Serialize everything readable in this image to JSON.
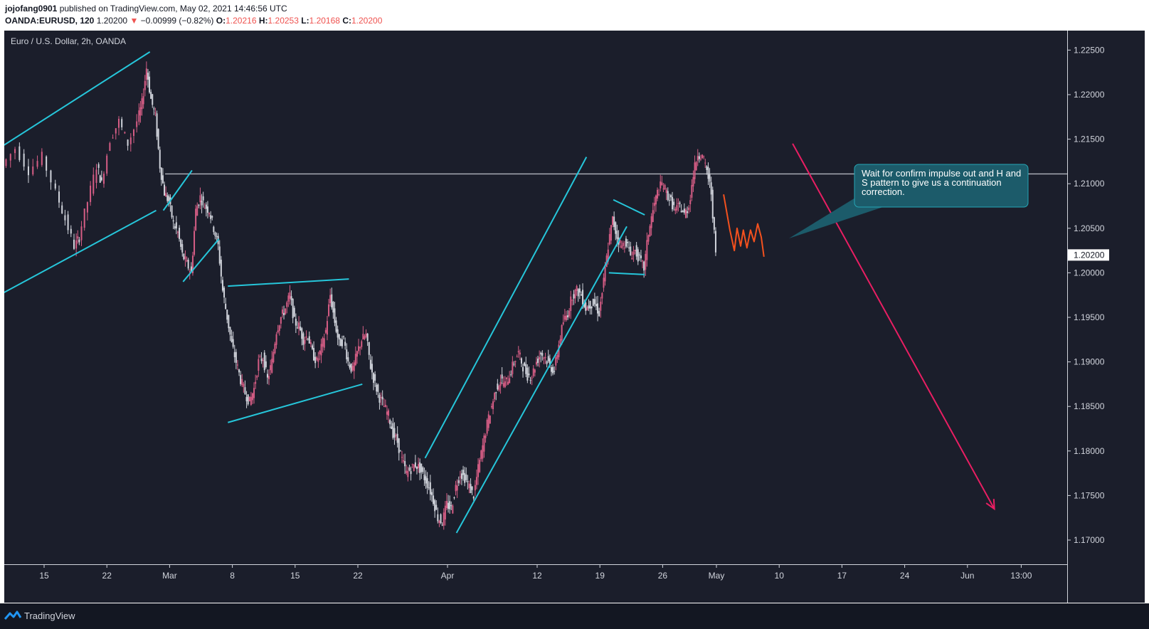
{
  "header": {
    "author": "jojofang0901",
    "published": "published on TradingView.com, May 02, 2021 14:46:56 UTC",
    "symbol": "OANDA:EURUSD, 120",
    "price": "1.20200",
    "change": "−0.00999 (−0.82%)",
    "open_label": "O:",
    "open": "1.20216",
    "high_label": "H:",
    "high": "1.20253",
    "low_label": "L:",
    "low": "1.20168",
    "close_label": "C:",
    "close": "1.20200"
  },
  "footer": {
    "brand": "TradingView",
    "logo_icon": "tradingview-logo-icon"
  },
  "colors": {
    "background": "#1b1e2b",
    "up": "#d65d85",
    "down": "#d1d4dc",
    "trendline": "#26c6da",
    "arrow": "#e91e63",
    "sketch": "#f4511e",
    "note_bg": "#1c5b6a",
    "note_border": "#26a6b5"
  },
  "chart_data": {
    "type": "candlestick",
    "title": "Euro / U.S. Dollar, 2h, OANDA",
    "ylim": [
      1.167,
      1.228
    ],
    "y_ticks": [
      "1.22500",
      "1.22000",
      "1.21500",
      "1.21000",
      "1.20500",
      "1.20000",
      "1.19500",
      "1.19000",
      "1.18500",
      "1.18000",
      "1.17500",
      "1.17000"
    ],
    "x_ticks": [
      {
        "label": "15",
        "day": 0
      },
      {
        "label": "22",
        "day": 7
      },
      {
        "label": "Mar",
        "day": 14
      },
      {
        "label": "8",
        "day": 21
      },
      {
        "label": "15",
        "day": 28
      },
      {
        "label": "22",
        "day": 35
      },
      {
        "label": "Apr",
        "day": 45
      },
      {
        "label": "12",
        "day": 55
      },
      {
        "label": "19",
        "day": 62
      },
      {
        "label": "26",
        "day": 69
      },
      {
        "label": "May",
        "day": 75
      },
      {
        "label": "10",
        "day": 82
      },
      {
        "label": "17",
        "day": 89
      },
      {
        "label": "24",
        "day": 96
      },
      {
        "label": "Jun",
        "day": 103
      },
      {
        "label": "13:00",
        "day": 109
      }
    ],
    "last_price": 1.202,
    "resistance_level": 1.2111,
    "price_path": [
      [
        -4.5,
        1.212
      ],
      [
        -3,
        1.214
      ],
      [
        -1.5,
        1.2115
      ],
      [
        0,
        1.213
      ],
      [
        1.5,
        1.209
      ],
      [
        2.5,
        1.206
      ],
      [
        3.5,
        1.203
      ],
      [
        4,
        1.204
      ],
      [
        5,
        1.208
      ],
      [
        6,
        1.212
      ],
      [
        6.5,
        1.21
      ],
      [
        7.5,
        1.215
      ],
      [
        8.5,
        1.217
      ],
      [
        9.5,
        1.2145
      ],
      [
        10.5,
        1.217
      ],
      [
        11,
        1.219
      ],
      [
        11.5,
        1.223
      ],
      [
        12,
        1.2195
      ],
      [
        12.5,
        1.2175
      ],
      [
        13,
        1.212
      ],
      [
        13.5,
        1.209
      ],
      [
        14,
        1.208
      ],
      [
        14.5,
        1.2055
      ],
      [
        15,
        1.2045
      ],
      [
        15.5,
        1.202
      ],
      [
        16,
        1.201
      ],
      [
        16.5,
        1.2
      ],
      [
        17,
        1.207
      ],
      [
        17.5,
        1.2085
      ],
      [
        18,
        1.2075
      ],
      [
        18.5,
        1.207
      ],
      [
        19,
        1.205
      ],
      [
        19.5,
        1.203
      ],
      [
        20,
        1.198
      ],
      [
        20.5,
        1.195
      ],
      [
        21,
        1.192
      ],
      [
        21.5,
        1.19
      ],
      [
        22,
        1.188
      ],
      [
        22.5,
        1.1865
      ],
      [
        23,
        1.1855
      ],
      [
        23.5,
        1.187
      ],
      [
        24,
        1.19
      ],
      [
        24.5,
        1.1905
      ],
      [
        25,
        1.188
      ],
      [
        25.5,
        1.19
      ],
      [
        26,
        1.1935
      ],
      [
        26.5,
        1.195
      ],
      [
        27,
        1.196
      ],
      [
        27.5,
        1.1975
      ],
      [
        28,
        1.1945
      ],
      [
        28.5,
        1.194
      ],
      [
        29,
        1.1925
      ],
      [
        29.5,
        1.193
      ],
      [
        30,
        1.191
      ],
      [
        30.5,
        1.19
      ],
      [
        31,
        1.1915
      ],
      [
        31.5,
        1.1935
      ],
      [
        32,
        1.1975
      ],
      [
        32.5,
        1.1945
      ],
      [
        33,
        1.192
      ],
      [
        33.5,
        1.1925
      ],
      [
        34,
        1.19
      ],
      [
        34.5,
        1.189
      ],
      [
        35,
        1.191
      ],
      [
        35.5,
        1.1925
      ],
      [
        36,
        1.193
      ],
      [
        36.5,
        1.1895
      ],
      [
        37,
        1.1875
      ],
      [
        37.5,
        1.186
      ],
      [
        38,
        1.185
      ],
      [
        38.5,
        1.184
      ],
      [
        39,
        1.182
      ],
      [
        39.5,
        1.181
      ],
      [
        40,
        1.179
      ],
      [
        40.5,
        1.1775
      ],
      [
        41,
        1.178
      ],
      [
        41.5,
        1.1785
      ],
      [
        42,
        1.178
      ],
      [
        42.5,
        1.177
      ],
      [
        43,
        1.176
      ],
      [
        43.5,
        1.1745
      ],
      [
        44,
        1.1725
      ],
      [
        44.5,
        1.172
      ],
      [
        45,
        1.174
      ],
      [
        45.5,
        1.1735
      ],
      [
        46,
        1.176
      ],
      [
        46.5,
        1.1775
      ],
      [
        47,
        1.177
      ],
      [
        47.5,
        1.176
      ],
      [
        48,
        1.175
      ],
      [
        48.5,
        1.178
      ],
      [
        49,
        1.1805
      ],
      [
        49.5,
        1.183
      ],
      [
        50,
        1.185
      ],
      [
        50.5,
        1.187
      ],
      [
        51,
        1.188
      ],
      [
        51.5,
        1.1875
      ],
      [
        52,
        1.1885
      ],
      [
        52.5,
        1.19
      ],
      [
        53,
        1.191
      ],
      [
        53.5,
        1.1895
      ],
      [
        54,
        1.1885
      ],
      [
        54.5,
        1.1885
      ],
      [
        55,
        1.19
      ],
      [
        55.5,
        1.191
      ],
      [
        56,
        1.1905
      ],
      [
        56.5,
        1.1895
      ],
      [
        57,
        1.189
      ],
      [
        57.5,
        1.192
      ],
      [
        58,
        1.1945
      ],
      [
        58.5,
        1.1955
      ],
      [
        59,
        1.1975
      ],
      [
        59.5,
        1.198
      ],
      [
        60,
        1.1975
      ],
      [
        60.5,
        1.196
      ],
      [
        61,
        1.1965
      ],
      [
        61.5,
        1.1965
      ],
      [
        62,
        1.1955
      ],
      [
        62.5,
        1.199
      ],
      [
        63,
        1.203
      ],
      [
        63.5,
        1.206
      ],
      [
        64,
        1.204
      ],
      [
        64.5,
        1.203
      ],
      [
        65,
        1.2035
      ],
      [
        65.5,
        1.202
      ],
      [
        66,
        1.2025
      ],
      [
        66.5,
        1.2015
      ],
      [
        67,
        1.2005
      ],
      [
        67.5,
        1.2045
      ],
      [
        68,
        1.207
      ],
      [
        68.5,
        1.209
      ],
      [
        69,
        1.21
      ],
      [
        69.5,
        1.209
      ],
      [
        70,
        1.208
      ],
      [
        70.5,
        1.207
      ],
      [
        71,
        1.2075
      ],
      [
        71.5,
        1.2065
      ],
      [
        72,
        1.2075
      ],
      [
        72.5,
        1.211
      ],
      [
        73,
        1.2135
      ],
      [
        73.5,
        1.213
      ],
      [
        74,
        1.2115
      ],
      [
        74.5,
        1.209
      ],
      [
        75,
        1.202
      ]
    ],
    "trendlines": [
      {
        "from": [
          -5,
          1.214
        ],
        "to": [
          11.8,
          1.2248
        ]
      },
      {
        "from": [
          -5,
          1.1975
        ],
        "to": [
          12.5,
          1.207
        ]
      },
      {
        "from": [
          13.3,
          1.207
        ],
        "to": [
          16.5,
          1.2115
        ]
      },
      {
        "from": [
          15.5,
          1.199
        ],
        "to": [
          19.5,
          1.2038
        ]
      },
      {
        "from": [
          20.5,
          1.1985
        ],
        "to": [
          34,
          1.1993
        ]
      },
      {
        "from": [
          20.5,
          1.1832
        ],
        "to": [
          35.5,
          1.1875
        ]
      },
      {
        "from": [
          42.5,
          1.1792
        ],
        "to": [
          60.5,
          1.213
        ]
      },
      {
        "from": [
          46,
          1.1708
        ],
        "to": [
          65,
          1.2052
        ]
      },
      {
        "from": [
          63.5,
          1.2082
        ],
        "to": [
          67,
          1.2065
        ]
      },
      {
        "from": [
          63,
          1.2
        ],
        "to": [
          67,
          1.1998
        ]
      }
    ],
    "projection_arrow": {
      "from": [
        83.5,
        1.2145
      ],
      "to": [
        106,
        1.1735
      ]
    },
    "annotation": "Wait for confirm impulse out and H and S pattern to give us a continuation correction."
  }
}
